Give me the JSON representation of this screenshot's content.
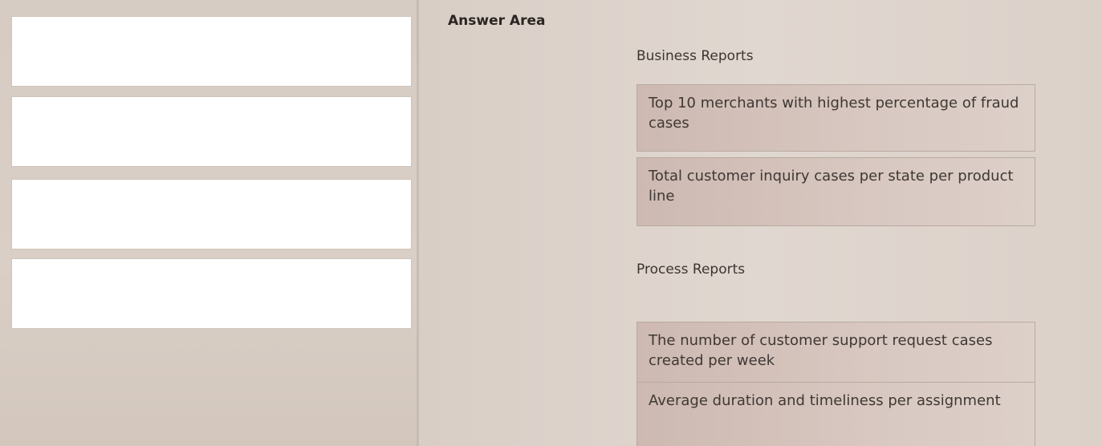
{
  "answer_area": {
    "title": "Answer Area",
    "sections": [
      {
        "heading": "Business Reports",
        "items": [
          "Top 10 merchants with highest percentage of fraud cases",
          "Total customer inquiry cases per state per product line"
        ]
      },
      {
        "heading": "Process Reports",
        "items": [
          "The number of customer support request cases created per week",
          "Average duration and timeliness per assignment"
        ]
      }
    ]
  },
  "drop_slots_count": 4
}
